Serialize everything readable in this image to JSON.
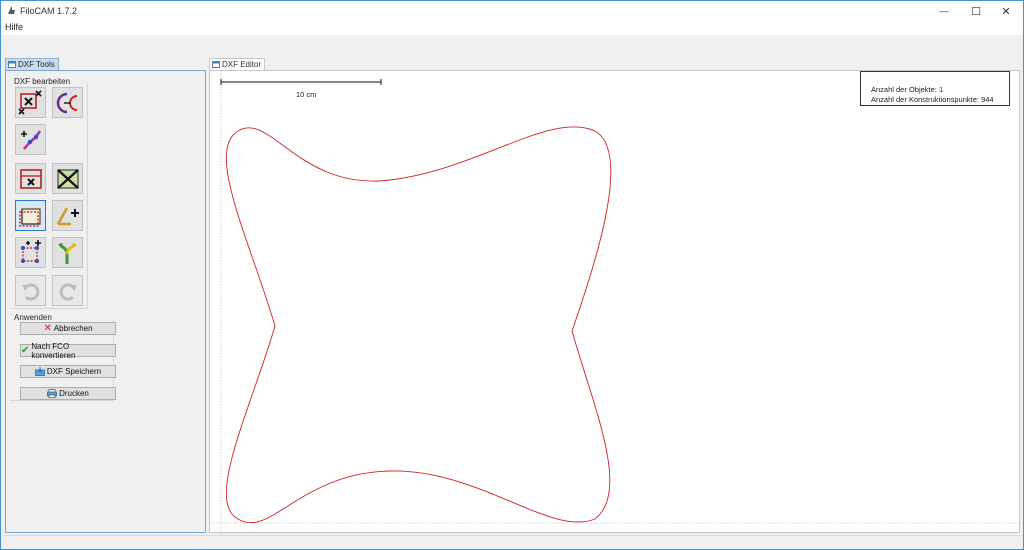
{
  "window": {
    "title": "FiloCAM 1.7.2",
    "minimize_glyph": "—",
    "maximize_glyph": "☐",
    "close_glyph": "✕"
  },
  "menu": {
    "help": "Hilfe"
  },
  "left_panel": {
    "tab_label": "DXF Tools",
    "edit_group_label": "DXF bearbeiten",
    "tools": [
      {
        "name": "delete-selection-tool",
        "icon": "delete-selection-icon"
      },
      {
        "name": "offset-contour-tool",
        "icon": "offset-contour-icon"
      },
      {
        "name": "move-point-tool",
        "icon": "move-point-icon"
      },
      {
        "name": "delete-object-tool",
        "icon": "delete-object-icon"
      },
      {
        "name": "delete-all-tool",
        "icon": "delete-all-icon"
      },
      {
        "name": "select-rectangle-tool",
        "icon": "select-rectangle-icon",
        "selected": true
      },
      {
        "name": "add-line-tool",
        "icon": "add-line-icon"
      },
      {
        "name": "add-points-tool",
        "icon": "add-points-icon"
      },
      {
        "name": "split-path-tool",
        "icon": "split-path-icon"
      },
      {
        "name": "undo-tool",
        "icon": "undo-icon",
        "disabled": true
      },
      {
        "name": "redo-tool",
        "icon": "redo-icon",
        "disabled": true
      }
    ],
    "apply_group_label": "Anwenden",
    "buttons": {
      "cancel": "Abbrechen",
      "convert": "Nach FCO konvertieren",
      "save": "DXF Speichern",
      "print": "Drucken"
    }
  },
  "editor": {
    "tab_label": "DXF Editor",
    "scale_label": "10 cm",
    "info": {
      "objects": "Anzahl der Objekte: 1",
      "points": "Anzahl der Konstruktionspunkte: 944"
    }
  },
  "colors": {
    "accent": "#2f79c9",
    "contour": "#d42020",
    "panel_border": "#7fa7cf"
  }
}
